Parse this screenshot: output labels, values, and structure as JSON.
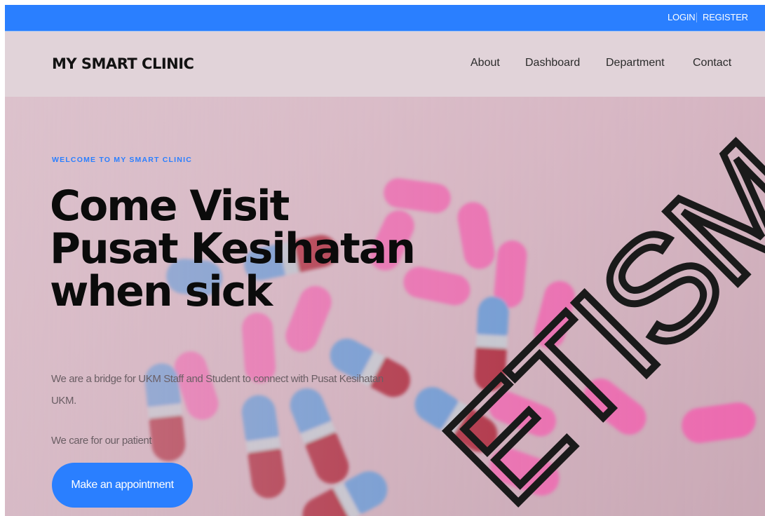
{
  "topbar": {
    "login": "LOGIN",
    "register": "REGISTER",
    "color": "#2a7fff"
  },
  "navbar": {
    "brand": "MY SMART CLINIC",
    "links": [
      "About",
      "Dashboard",
      "Department",
      "Contact"
    ]
  },
  "hero": {
    "eyebrow": "WELCOME TO MY SMART CLINIC",
    "headline": [
      "Come Visit",
      "Pusat Kesihatan",
      "when sick"
    ],
    "description": "We are a bridge for UKM Staff and Student to connect with Pusat Kesihatan UKM.",
    "tagline": "We care for our patient",
    "cta": "Make an appointment"
  },
  "watermark": {
    "text": "ETISM"
  },
  "colors": {
    "accent": "#2a7fff",
    "navbar_bg": "#e1d3d9",
    "hero_bg": "#d7b6c3",
    "pill_pink": "#f25fb0",
    "pill_red": "#a8182a",
    "pill_blue": "#4d8fd6"
  }
}
